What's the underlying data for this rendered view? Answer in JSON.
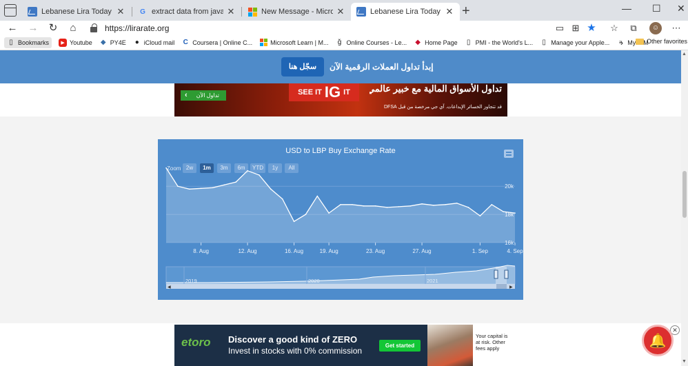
{
  "tabs": [
    {
      "title": "Lebanese Lira Today | Dollar to L",
      "favicon": "chart-icon",
      "active": false
    },
    {
      "title": "extract data from java webpage",
      "favicon": "google-icon",
      "active": false
    },
    {
      "title": "New Message - Microsoft Tech C",
      "favicon": "microsoft-icon",
      "active": false
    },
    {
      "title": "Lebanese Lira Today | Dollar to L",
      "favicon": "chart-icon",
      "active": true
    }
  ],
  "address": {
    "url": "https://lirarate.org"
  },
  "bookmarks": [
    {
      "label": "Bookmarks",
      "icon": "page-icon"
    },
    {
      "label": "Youtube",
      "icon": "youtube-icon"
    },
    {
      "label": "PY4E",
      "icon": "python-icon"
    },
    {
      "label": "iCloud mail",
      "icon": "apple-icon"
    },
    {
      "label": "Coursera | Online C...",
      "icon": "coursera-icon"
    },
    {
      "label": "Microsoft Learn | M...",
      "icon": "microsoft-icon"
    },
    {
      "label": "Online Courses - Le...",
      "icon": "edx-icon"
    },
    {
      "label": "Home Page",
      "icon": "shield-icon"
    },
    {
      "label": "PMI - the World's L...",
      "icon": "page-icon"
    },
    {
      "label": "Manage your Apple...",
      "icon": "page-icon"
    },
    {
      "label": "My IBM",
      "icon": "ibm-icon"
    }
  ],
  "other_favorites": "Other favorites",
  "banner": {
    "signup_label": "سجّل هنا",
    "text": "إبدأ تداول العملات الرقمية الآن"
  },
  "ig_ad": {
    "button": "تداول الآن",
    "logo_left": "SEE IT",
    "logo_mid": "IG",
    "logo_right": "IT",
    "headline": "تداول الأسواق المالية مع خبير عالمي",
    "disclaimer": "قد تتجاوز الخسائر الإيداعات. آي جي مرخصة من قبل DFSA"
  },
  "chart_data": {
    "type": "line",
    "title": "USD to LBP Buy Exchange Rate",
    "zoom_label": "Zoom",
    "zoom_buttons": [
      "2w",
      "1m",
      "3m",
      "6m",
      "YTD",
      "1y",
      "All"
    ],
    "zoom_selected": "1m",
    "x_tick_labels": [
      "8. Aug",
      "12. Aug",
      "16. Aug",
      "19. Aug",
      "23. Aug",
      "27. Aug",
      "1. Sep",
      "4. Sep"
    ],
    "y_tick_labels": [
      "20k",
      "18k",
      "16k"
    ],
    "ylim": [
      16000,
      20500
    ],
    "x": [
      "5. Aug",
      "6. Aug",
      "7. Aug",
      "8. Aug",
      "9. Aug",
      "10. Aug",
      "11. Aug",
      "12. Aug",
      "13. Aug",
      "14. Aug",
      "15. Aug",
      "16. Aug",
      "17. Aug",
      "18. Aug",
      "19. Aug",
      "20. Aug",
      "21. Aug",
      "22. Aug",
      "23. Aug",
      "24. Aug",
      "25. Aug",
      "26. Aug",
      "27. Aug",
      "28. Aug",
      "29. Aug",
      "30. Aug",
      "31. Aug",
      "1. Sep",
      "2. Sep",
      "3. Sep",
      "4. Sep"
    ],
    "y": [
      21300,
      20000,
      19800,
      19850,
      19900,
      20100,
      20300,
      21100,
      20800,
      19800,
      19100,
      17500,
      18000,
      19300,
      18100,
      18700,
      18700,
      18600,
      18600,
      18500,
      18550,
      18600,
      18750,
      18650,
      18700,
      18800,
      18500,
      17900,
      18700,
      18200,
      18100
    ],
    "navigator_labels": [
      "2019",
      "2020",
      "2021"
    ],
    "grid": true
  },
  "etoro_ad": {
    "logo": "etoro",
    "headline": "Discover a good kind of ZERO",
    "subline": "Invest in stocks with 0% commission",
    "button": "Get started",
    "note": "Your capital is at risk. Other fees apply"
  }
}
